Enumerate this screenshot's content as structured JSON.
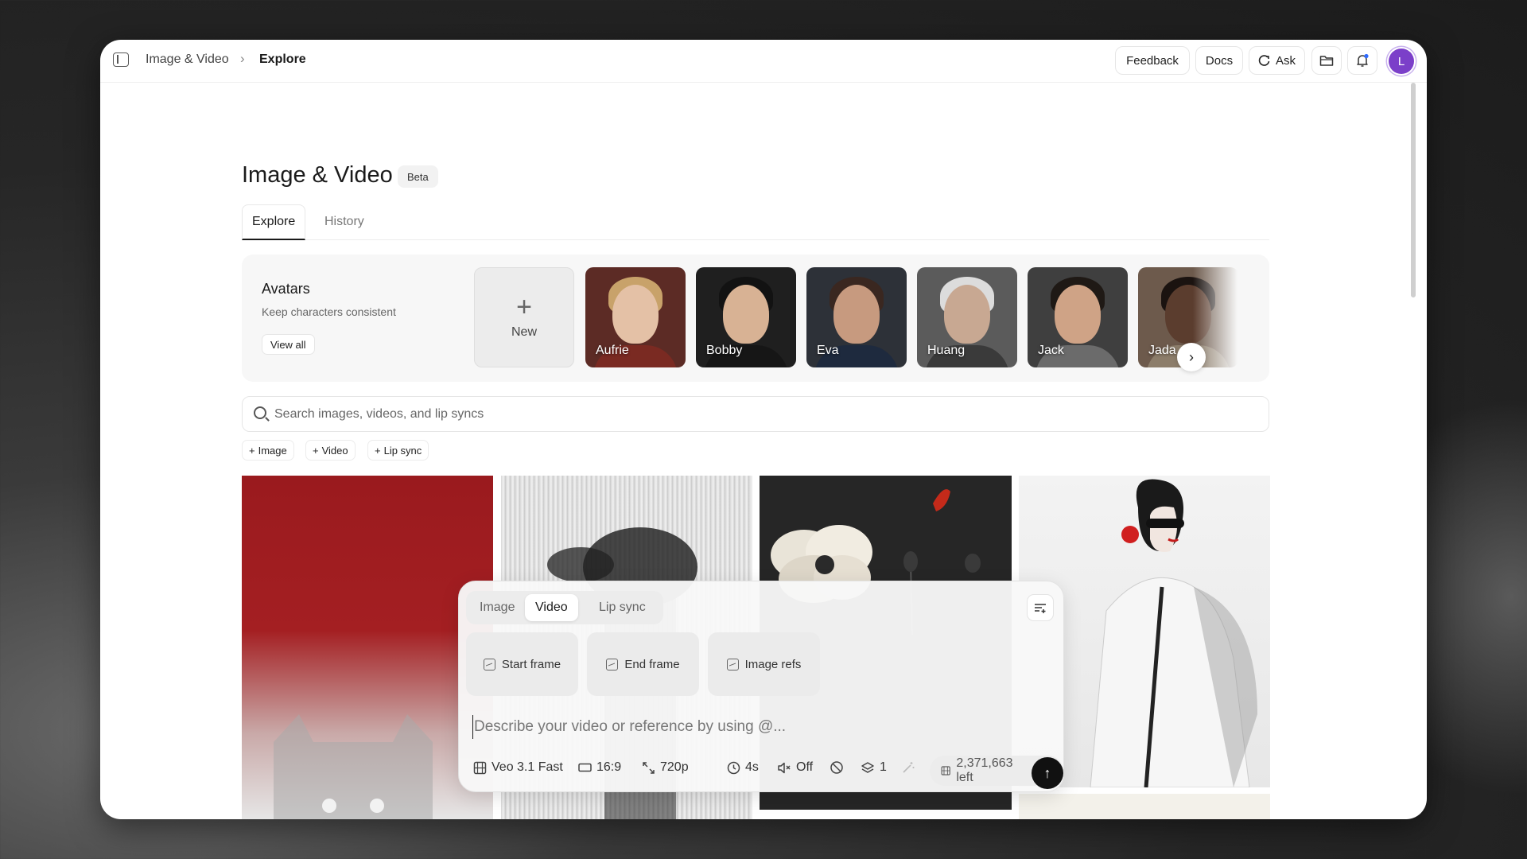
{
  "breadcrumb": {
    "root": "Image & Video",
    "current": "Explore"
  },
  "topbar": {
    "feedback": "Feedback",
    "docs": "Docs",
    "ask": "Ask",
    "avatar_initial": "L"
  },
  "page": {
    "title": "Image & Video",
    "badge": "Beta"
  },
  "tabs": [
    {
      "label": "Explore",
      "active": true
    },
    {
      "label": "History",
      "active": false
    }
  ],
  "avatars": {
    "title": "Avatars",
    "subtitle": "Keep characters consistent",
    "view_all": "View all",
    "new_label": "New",
    "items": [
      {
        "name": "Aufrie",
        "bg": "#5c2b25",
        "skin": "#e4c1a6",
        "hair": "#c8a26a",
        "body": "#7a2a22"
      },
      {
        "name": "Bobby",
        "bg": "#1f1f1f",
        "skin": "#d8b294",
        "hair": "#121212",
        "body": "#161616"
      },
      {
        "name": "Eva",
        "bg": "#2d3138",
        "skin": "#c79a7f",
        "hair": "#3a2720",
        "body": "#1e2a3e"
      },
      {
        "name": "Huang",
        "bg": "#5b5b5b",
        "skin": "#c8a892",
        "hair": "#dcdcdc",
        "body": "#3a3a3a"
      },
      {
        "name": "Jack",
        "bg": "#3f3f3f",
        "skin": "#cfa386",
        "hair": "#1f1915",
        "body": "#6b6b6b"
      },
      {
        "name": "Jada",
        "bg": "#6d5a4c",
        "skin": "#5b3d2e",
        "hair": "#1b1310",
        "body": "#8c7d6a"
      }
    ]
  },
  "search": {
    "placeholder": "Search images, videos, and lip syncs"
  },
  "filter_chips": [
    "Image",
    "Video",
    "Lip sync"
  ],
  "composer": {
    "modes": [
      "Image",
      "Video",
      "Lip sync"
    ],
    "active_mode": "Video",
    "frames": [
      "Start frame",
      "End frame",
      "Image refs"
    ],
    "prompt_placeholder": "Describe your video or reference by using @...",
    "model": "Veo 3.1 Fast",
    "aspect": "16:9",
    "resolution": "720p",
    "duration": "4s",
    "audio": "Off",
    "count": "1",
    "credits": "2,371,663 left"
  }
}
